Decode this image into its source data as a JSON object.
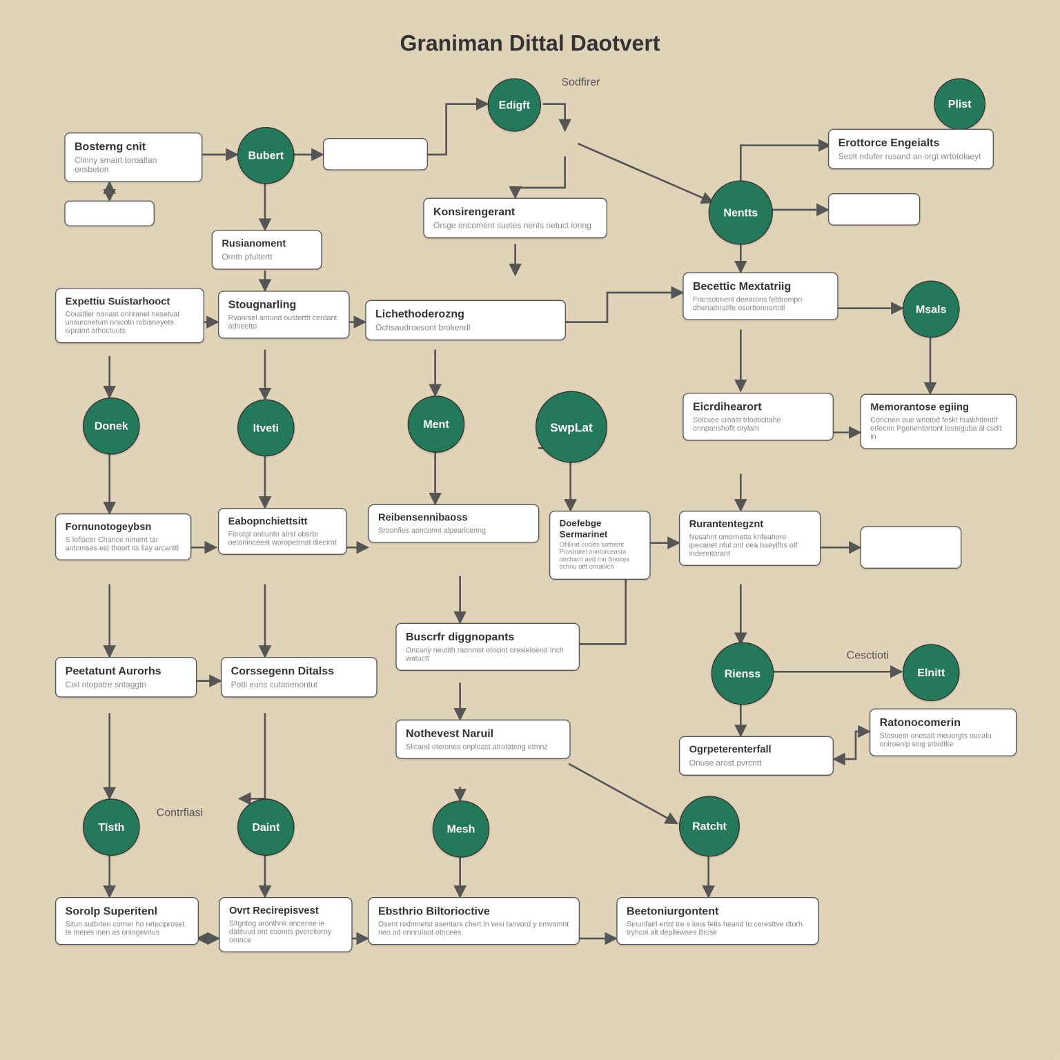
{
  "title": "Graniman Dittal Daotvert",
  "labels": {
    "sodfirer": "Sodfirer",
    "contrfiasi": "Contrfiasi",
    "cesctioti": "Cesctioti"
  },
  "circles": {
    "bubert": "Bubert",
    "edigft": "Edigft",
    "plist": "Plist",
    "nentts": "Nentts",
    "donek": "Donek",
    "itveti": "Itveti",
    "msals": "Msals",
    "ment": "Ment",
    "swplat": "SwpLat",
    "rienss": "Rienss",
    "elnitt": "Elnitt",
    "tlsth": "Tlsth",
    "daint": "Daint",
    "mesh": "Mesh",
    "ratcht": "Ratcht"
  },
  "boxes": {
    "bosterng": {
      "h": "Bosterng cnit",
      "d": "Clinny smairt toroaltan ensbeton"
    },
    "erottorce": {
      "h": "Erottorce Engeialts",
      "d": "Seolt ndufer rusand an orgt wrtotolaeyt"
    },
    "konsirengerant": {
      "h": "Konsirengerant",
      "d": "Orsge oncoment suetes nents netuct ionng"
    },
    "rusianoment": {
      "h": "Rusianoment",
      "d": "Ornth pfultertt"
    },
    "expettiu": {
      "h": "Expettiu Suistarhooct",
      "d": "Coustlier nonast onnranet nesetvat unsurcnetum nrscotn robisneyets ivpramt athoctuuts"
    },
    "stougnarling": {
      "h": "Stougnarling",
      "d": "Rvonrsel amund ousterttt cerdant adneetto"
    },
    "lichethoderozng": {
      "h": "Lichethoderozng",
      "d": "Ochsaudroesont brokendl"
    },
    "becettic": {
      "h": "Becettic Mextatriig",
      "d": "Fransotment deeorons febtrompn dhenathratlfe osorttonnortntl"
    },
    "eicrdihearort": {
      "h": "Eicrdihearort",
      "d": "Soicxee croast trlooticitahe onnpanshoflt orylam"
    },
    "memorantose": {
      "h": "Memorantose egiing",
      "d": "Concnen aue wnotod feskt huakhtlentif erlecnn Pgenentortont losteguba al csdit in"
    },
    "fornunotogeybsn": {
      "h": "Fornunotogeybsn",
      "d": "S loflacer Chance niment tar antomses est thoort its liay arcanttl"
    },
    "eabopnchiettsitt": {
      "h": "Eabopnchiettsitt",
      "d": "Fitrotgt ontiuntn atrst obsrbr oetoninceest woropetrnat diecirnt"
    },
    "reibensennibaoss": {
      "h": "Reibensennibaoss",
      "d": "Sroonfies aonconnt alpearicenng"
    },
    "doefebge": {
      "h": "Doefebge Sermarinet",
      "d": "Ofillirat cucles sathient Prostratel onntorceasta decharrt aed mn Snocex schnu otft onratvch"
    },
    "rurantentegznt": {
      "h": "Rurantentegznt",
      "d": "Nosahnt omornetts knfeahore ipecanet ntut ont oea baeyiflrs otf indenntorant"
    },
    "buscrfr": {
      "h": "Buscrfr diggnopants",
      "d": "Oncany neutith raonmst otocint oresieloend Inch watuctt"
    },
    "peetatunt": {
      "h": "Peetatunt Aurorhs",
      "d": "Coil ntopatre sntaggtn"
    },
    "corssegenn": {
      "h": "Corssegenn Ditalss",
      "d": "Potll euns cutanenontut"
    },
    "nothevest": {
      "h": "Nothevest Naruil",
      "d": "Slicand oterones onploast atrotateng etmnz"
    },
    "ogrpeterenterfall": {
      "h": "Ogrpeterenterfall",
      "d": "Onuse arost pvrcntt"
    },
    "ratonocomerin": {
      "h": "Ratonocomerin",
      "d": "Stosuem onesatt meuorgts oucalu oniroenlp sing srbidtke"
    },
    "sorolp": {
      "h": "Sorolp Superitenl",
      "d": "Situn sutbrten corner ho reteciproset te meres inen as oningevrius"
    },
    "ovrt": {
      "h": "Ovrt Recirepisvest",
      "d": "Sltgntog aronthnk ancense ie datituud ont esomts pverciterny omnce"
    },
    "ebsthrio": {
      "h": "Ebsthrio Biltorioctive",
      "d": "Osent rodmnetst asentars chert ln vesi tanvord y omvomnt neo od onnrulaot otncees"
    },
    "beetoniurgontent": {
      "h": "Beetoniurgontent",
      "d": "Sinunfairl ertol tre s lous fetis heand to ceresttve dtorh tryhcol alt depllewses Brcsk"
    }
  }
}
